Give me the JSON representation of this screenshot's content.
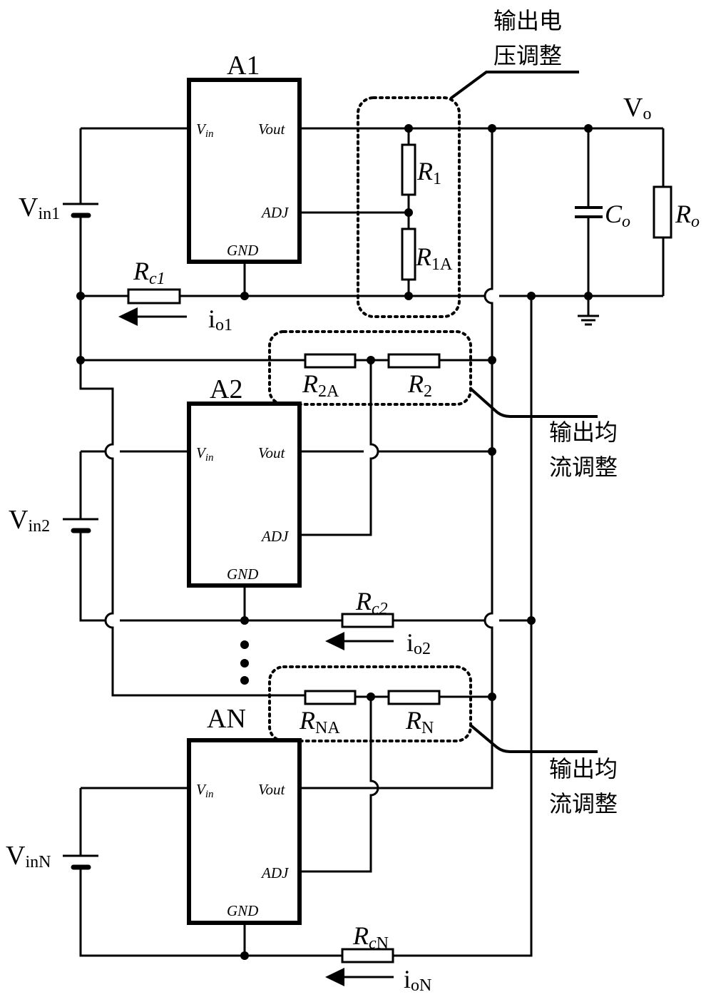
{
  "diagram": {
    "type": "circuit-schematic",
    "modules": [
      {
        "name": "A1",
        "pins": {
          "vin": "V",
          "vin_sub": "in",
          "vout": "Vout",
          "adj": "ADJ",
          "gnd": "GND"
        }
      },
      {
        "name": "A2",
        "pins": {
          "vin": "V",
          "vin_sub": "in",
          "vout": "Vout",
          "adj": "ADJ",
          "gnd": "GND"
        }
      },
      {
        "name": "AN",
        "pins": {
          "vin": "V",
          "vin_sub": "in",
          "vout": "Vout",
          "adj": "ADJ",
          "gnd": "GND"
        }
      }
    ],
    "sources": [
      {
        "main": "V",
        "sub": "in1"
      },
      {
        "main": "V",
        "sub": "in2"
      },
      {
        "main": "V",
        "sub": "inN"
      }
    ],
    "resistors": {
      "r1": {
        "main": "R",
        "sub": "1"
      },
      "r1a": {
        "main": "R",
        "sub": "1A"
      },
      "r2": {
        "main": "R",
        "sub": "2"
      },
      "r2a": {
        "main": "R",
        "sub": "2A"
      },
      "rn": {
        "main": "R",
        "sub": "N"
      },
      "rna": {
        "main": "R",
        "sub": "NA"
      },
      "rc1": {
        "main": "R",
        "sub": "c1"
      },
      "rc2": {
        "main": "R",
        "sub": "c2"
      },
      "rcn": {
        "main": "R",
        "sub": "c",
        "sub2": "N"
      },
      "ro": {
        "main": "R",
        "sub": "o"
      }
    },
    "capacitor": {
      "main": "C",
      "sub": "o"
    },
    "output_voltage": {
      "main": "V",
      "sub": "o"
    },
    "currents": [
      {
        "main": "i",
        "sub": "o1"
      },
      {
        "main": "i",
        "sub": "o2"
      },
      {
        "main": "i",
        "sub": "oN"
      }
    ],
    "annotations": {
      "voltage_adjust_line1": "输出电",
      "voltage_adjust_line2": "压调整",
      "current_share_1_line1": "输出均",
      "current_share_1_line2": "流调整",
      "current_share_n_line1": "输出均",
      "current_share_n_line2": "流调整"
    },
    "ellipsis": "⋮"
  }
}
